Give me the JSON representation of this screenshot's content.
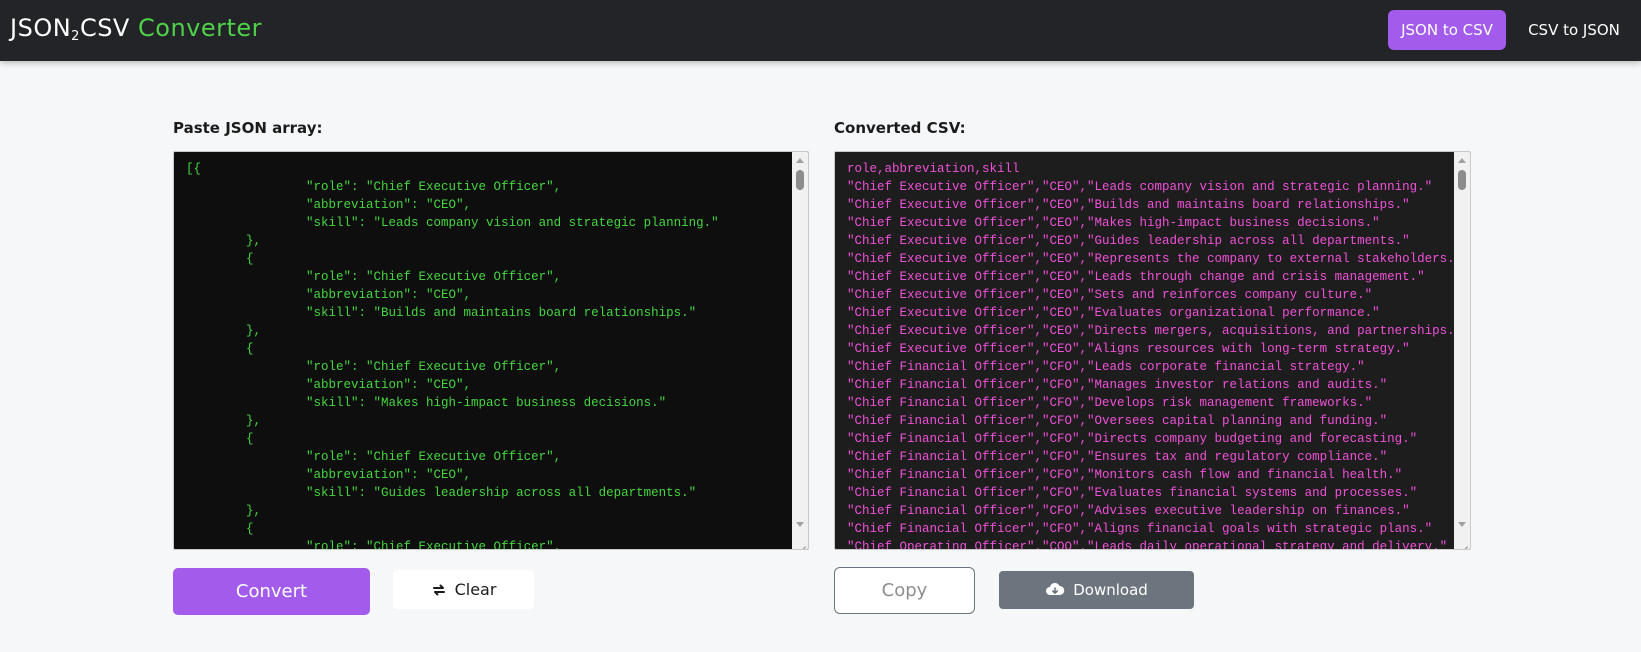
{
  "header": {
    "logo_main": "JSON",
    "logo_sub": "2",
    "logo_tail": "CSV",
    "logo_accent": "Converter",
    "nav": [
      {
        "label": "JSON to CSV",
        "active": true
      },
      {
        "label": "CSV to JSON",
        "active": false
      }
    ]
  },
  "colors": {
    "accent": "#a25bea",
    "logo_green": "#4fd14a",
    "json_text": "#46d640",
    "csv_text": "#f051d8",
    "download_bg": "#6c757d"
  },
  "left_panel": {
    "label": "Paste JSON array:",
    "content": "[{\n\t\t\"role\": \"Chief Executive Officer\",\n\t\t\"abbreviation\": \"CEO\",\n\t\t\"skill\": \"Leads company vision and strategic planning.\"\n\t},\n\t{\n\t\t\"role\": \"Chief Executive Officer\",\n\t\t\"abbreviation\": \"CEO\",\n\t\t\"skill\": \"Builds and maintains board relationships.\"\n\t},\n\t{\n\t\t\"role\": \"Chief Executive Officer\",\n\t\t\"abbreviation\": \"CEO\",\n\t\t\"skill\": \"Makes high-impact business decisions.\"\n\t},\n\t{\n\t\t\"role\": \"Chief Executive Officer\",\n\t\t\"abbreviation\": \"CEO\",\n\t\t\"skill\": \"Guides leadership across all departments.\"\n\t},\n\t{\n\t\t\"role\": \"Chief Executive Officer\","
  },
  "right_panel": {
    "label": "Converted CSV:",
    "content": "role,abbreviation,skill\n\"Chief Executive Officer\",\"CEO\",\"Leads company vision and strategic planning.\"\n\"Chief Executive Officer\",\"CEO\",\"Builds and maintains board relationships.\"\n\"Chief Executive Officer\",\"CEO\",\"Makes high-impact business decisions.\"\n\"Chief Executive Officer\",\"CEO\",\"Guides leadership across all departments.\"\n\"Chief Executive Officer\",\"CEO\",\"Represents the company to external stakeholders.\"\n\"Chief Executive Officer\",\"CEO\",\"Leads through change and crisis management.\"\n\"Chief Executive Officer\",\"CEO\",\"Sets and reinforces company culture.\"\n\"Chief Executive Officer\",\"CEO\",\"Evaluates organizational performance.\"\n\"Chief Executive Officer\",\"CEO\",\"Directs mergers, acquisitions, and partnerships.\"\n\"Chief Executive Officer\",\"CEO\",\"Aligns resources with long-term strategy.\"\n\"Chief Financial Officer\",\"CFO\",\"Leads corporate financial strategy.\"\n\"Chief Financial Officer\",\"CFO\",\"Manages investor relations and audits.\"\n\"Chief Financial Officer\",\"CFO\",\"Develops risk management frameworks.\"\n\"Chief Financial Officer\",\"CFO\",\"Oversees capital planning and funding.\"\n\"Chief Financial Officer\",\"CFO\",\"Directs company budgeting and forecasting.\"\n\"Chief Financial Officer\",\"CFO\",\"Ensures tax and regulatory compliance.\"\n\"Chief Financial Officer\",\"CFO\",\"Monitors cash flow and financial health.\"\n\"Chief Financial Officer\",\"CFO\",\"Evaluates financial systems and processes.\"\n\"Chief Financial Officer\",\"CFO\",\"Advises executive leadership on finances.\"\n\"Chief Financial Officer\",\"CFO\",\"Aligns financial goals with strategic plans.\"\n\"Chief Operating Officer\",\"COO\",\"Leads daily operational strategy and delivery.\""
  },
  "buttons": {
    "convert": "Convert",
    "clear": "Clear",
    "clear_icon": "swap-arrows-icon",
    "copy": "Copy",
    "download": "Download",
    "download_icon": "cloud-download-icon"
  }
}
